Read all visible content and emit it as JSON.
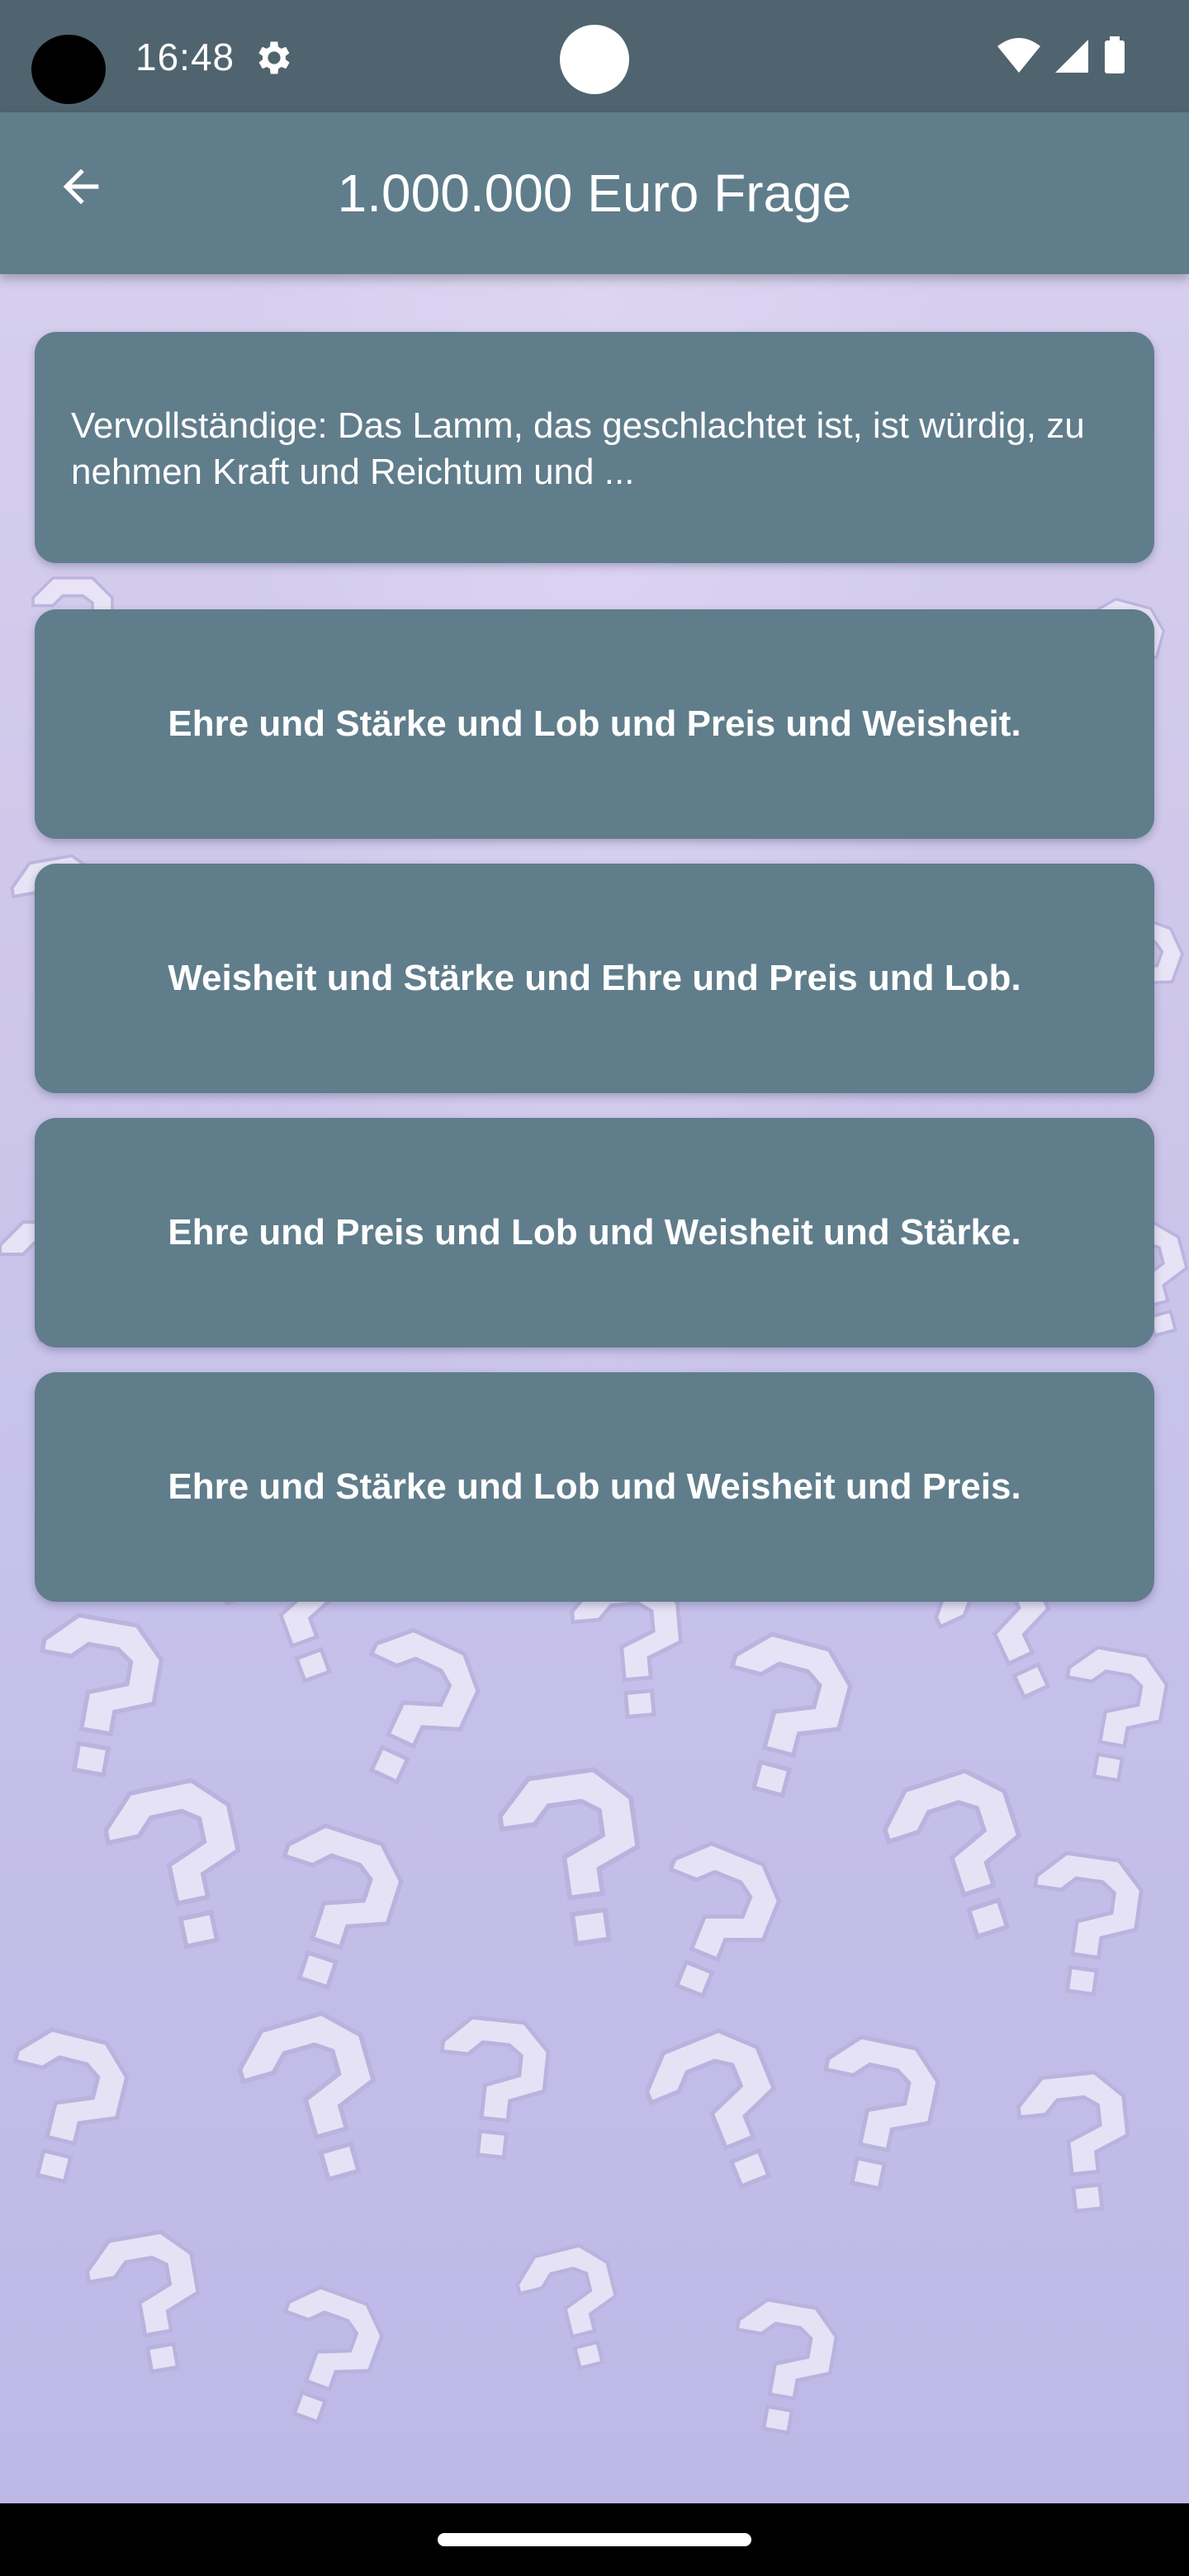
{
  "status_bar": {
    "time": "16:48"
  },
  "app_bar": {
    "title": "1.000.000 Euro Frage",
    "back_icon": "arrow-back-icon"
  },
  "question": {
    "text": "Vervollständige: Das Lamm, das geschlachtet ist, ist würdig, zu nehmen Kraft und Reichtum und ..."
  },
  "answers": [
    {
      "label": "Ehre und Stärke und Lob und Preis und Weisheit."
    },
    {
      "label": "Weisheit und Stärke und Ehre und Preis und Lob."
    },
    {
      "label": "Ehre und Preis und Lob und Weisheit und Stärke."
    },
    {
      "label": "Ehre und Stärke und Lob und Weisheit und Preis."
    }
  ],
  "colors": {
    "status_bar": "#4f646f",
    "app_bar": "#607d8b",
    "card": "#607d8b",
    "background": "#c9c3e6",
    "nav_bar": "#000000"
  },
  "icons": {
    "settings": "gear-icon",
    "wifi": "wifi-icon",
    "signal": "signal-icon",
    "battery": "battery-icon"
  }
}
